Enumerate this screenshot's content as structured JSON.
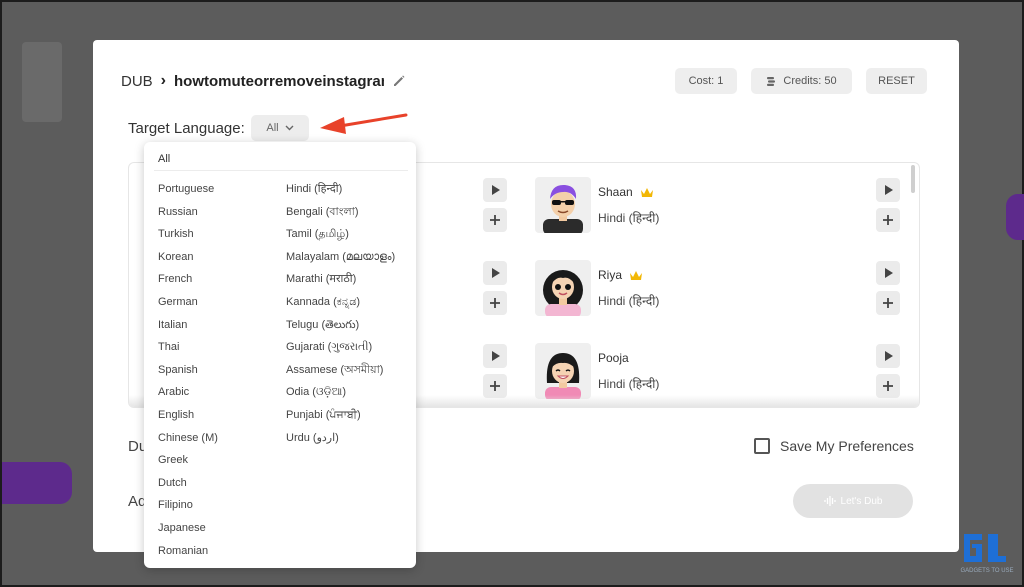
{
  "header": {
    "crumb_root": "DUB",
    "file_name": "howtomuteorremoveinstagram",
    "cost": "Cost: 1",
    "credits": "Credits: 50",
    "reset": "RESET"
  },
  "target_language": {
    "label": "Target Language:",
    "selected": "All"
  },
  "voices": [
    {
      "name": "Shaan",
      "lang": "Hindi (हिन्दी)",
      "premium": true
    },
    {
      "name": "Riya",
      "lang": "Hindi (हिन्दी)",
      "premium": true
    },
    {
      "name": "Pooja",
      "lang": "Hindi (हिन्दी)",
      "premium": false
    }
  ],
  "partial_labels": {
    "left_a": "Du",
    "left_b": "Ad"
  },
  "save_preferences": "Save My Preferences",
  "lets_dub": "Let's Dub",
  "dropdown": {
    "all": "All",
    "col1": [
      "Portuguese",
      "Russian",
      "Turkish",
      "Korean",
      "French",
      "German",
      "Italian",
      "Thai",
      "Spanish",
      "Arabic",
      "English",
      "Chinese (M)",
      "Greek",
      "Dutch",
      "Filipino",
      "Japanese",
      "Romanian"
    ],
    "col2": [
      "Hindi (हिन्दी)",
      "Bengali (বাংলা)",
      "Tamil (தமிழ்)",
      "Malayalam (മലയാളം)",
      "Marathi (मराठी)",
      "Kannada (ಕನ್ನಡ)",
      "Telugu (తెలుగు)",
      "Gujarati (ગુજરાતી)",
      "Assamese (অসমীয়া)",
      "Odia (ଓଡ଼ିଆ)",
      "Punjabi (ਪੰਜਾਬੀ)",
      "Urdu (اردو)"
    ]
  },
  "watermark": "GADGETS TO USE",
  "colors": {
    "arrow": "#e8422a",
    "crown": "#f2b705",
    "modal": "#ffffff"
  }
}
